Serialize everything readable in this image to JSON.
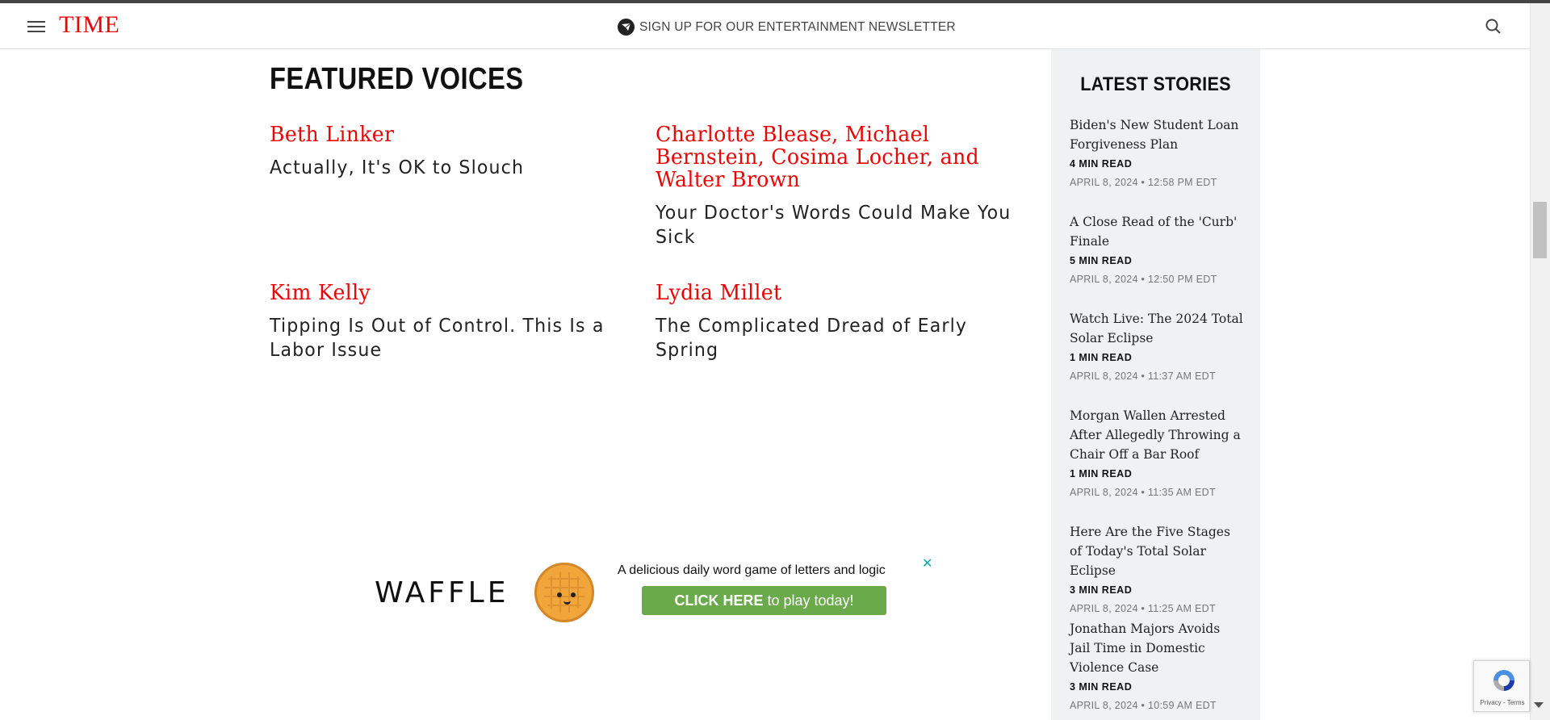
{
  "header": {
    "logo": "TIME",
    "newsletter_label": "SIGN UP FOR OUR ENTERTAINMENT NEWSLETTER"
  },
  "featured": {
    "title": "FEATURED VOICES",
    "items": [
      {
        "author": "Beth Linker",
        "headline": "Actually, It's OK to Slouch"
      },
      {
        "author": "Charlotte Blease, Michael Bernstein, Cosima Locher, and Walter Brown",
        "headline": "Your Doctor's Words Could Make You Sick"
      },
      {
        "author": "Kim Kelly",
        "headline": "Tipping Is Out of Control. This Is a Labor Issue"
      },
      {
        "author": "Lydia Millet",
        "headline": "The Complicated Dread of Early Spring"
      }
    ]
  },
  "ad": {
    "brand": "WAFFLE",
    "tagline": "A delicious daily word game of letters and logic",
    "cta_bold": "CLICK HERE",
    "cta_rest": " to play today!",
    "close": "✕"
  },
  "sidebar": {
    "title": "LATEST STORIES",
    "stories": [
      {
        "title": "Biden's New Student Loan Forgiveness Plan",
        "read": "4 MIN READ",
        "date": "APRIL 8, 2024 • 12:58 PM EDT"
      },
      {
        "title": "A Close Read of the 'Curb' Finale",
        "read": "5 MIN READ",
        "date": "APRIL 8, 2024 • 12:50 PM EDT"
      },
      {
        "title": "Watch Live: The 2024 Total Solar Eclipse",
        "read": "1 MIN READ",
        "date": "APRIL 8, 2024 • 11:37 AM EDT"
      },
      {
        "title": "Morgan Wallen Arrested After Allegedly Throwing a Chair Off a Bar Roof",
        "read": "1 MIN READ",
        "date": "APRIL 8, 2024 • 11:35 AM EDT"
      },
      {
        "title": "Here Are the Five Stages of Today's Total Solar Eclipse",
        "read": "3 MIN READ",
        "date": "APRIL 8, 2024 • 11:25 AM EDT"
      },
      {
        "title": "Jonathan Majors Avoids Jail Time in Domestic Violence Case",
        "read": "3 MIN READ",
        "date": "APRIL 8, 2024 • 10:59 AM EDT"
      }
    ]
  },
  "recaptcha": {
    "text": "Privacy - Terms"
  },
  "colors": {
    "brand_red": "#e90606",
    "sidebar_bg": "#f0f1f3",
    "cta_green": "#6aaa4b"
  },
  "icons": [
    "hamburger-menu-icon",
    "newsletter-mail-icon",
    "search-icon",
    "recaptcha-icon",
    "waffle-mascot-icon",
    "close-icon"
  ]
}
